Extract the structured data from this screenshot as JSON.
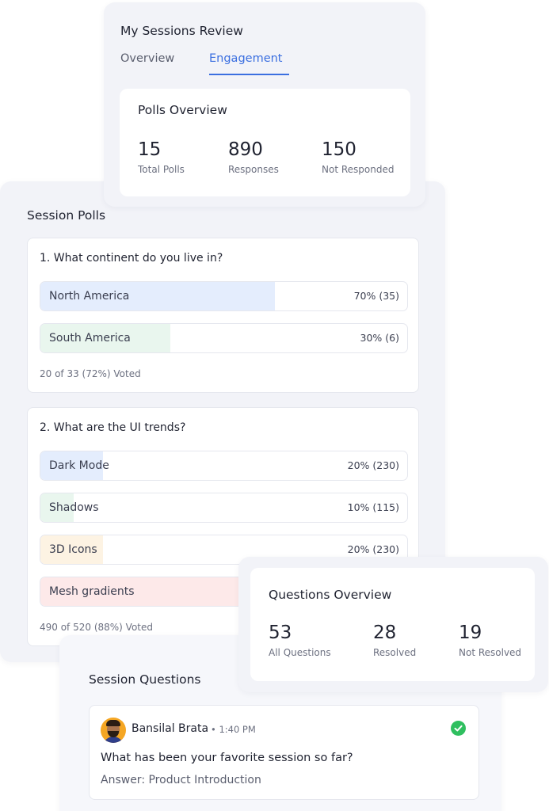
{
  "review": {
    "title": "My Sessions Review",
    "tabs": [
      {
        "label": "Overview",
        "active": false
      },
      {
        "label": "Engagement",
        "active": true
      }
    ],
    "polls_overview": {
      "title": "Polls Overview",
      "stats": [
        {
          "value": "15",
          "caption": "Total Polls"
        },
        {
          "value": "890",
          "caption": "Responses"
        },
        {
          "value": "150",
          "caption": "Not Responded"
        }
      ]
    }
  },
  "session_polls": {
    "title": "Session Polls",
    "polls": [
      {
        "question": "1. What continent do you live in?",
        "options": [
          {
            "label": "North America",
            "percent_text": "70% (35)",
            "fill": 0.64,
            "color": "#e4edfd"
          },
          {
            "label": "South America",
            "percent_text": "30% (6)",
            "fill": 0.355,
            "color": "#e9f6ee"
          }
        ],
        "voted": "20 of 33 (72%) Voted"
      },
      {
        "question": "2. What are the UI trends?",
        "options": [
          {
            "label": "Dark Mode",
            "percent_text": "20% (230)",
            "fill": 0.17,
            "color": "#e4edfd"
          },
          {
            "label": "Shadows",
            "percent_text": "10% (115)",
            "fill": 0.09,
            "color": "#e9f6ee"
          },
          {
            "label": "3D Icons",
            "percent_text": "20% (230)",
            "fill": 0.17,
            "color": "#fdf3e3"
          },
          {
            "label": "Mesh gradients",
            "percent_text": "",
            "fill": 0.56,
            "color": "#fde9e9"
          }
        ],
        "voted": "490 of 520 (88%) Voted"
      }
    ]
  },
  "questions_overview": {
    "title": "Questions Overview",
    "stats": [
      {
        "value": "53",
        "caption": "All Questions"
      },
      {
        "value": "28",
        "caption": "Resolved"
      },
      {
        "value": "19",
        "caption": "Not Resolved"
      }
    ]
  },
  "session_questions": {
    "title": "Session Questions",
    "items": [
      {
        "author": "Bansilal Brata",
        "time": "• 1:40 PM",
        "question": "What has been your favorite session so far?",
        "answer": "Answer: Product Introduction",
        "resolved": true
      }
    ]
  },
  "colors": {
    "accent": "#3b6fe0",
    "success": "#2fbf5f"
  },
  "icons": [
    "check-circle-icon",
    "avatar-icon"
  ]
}
